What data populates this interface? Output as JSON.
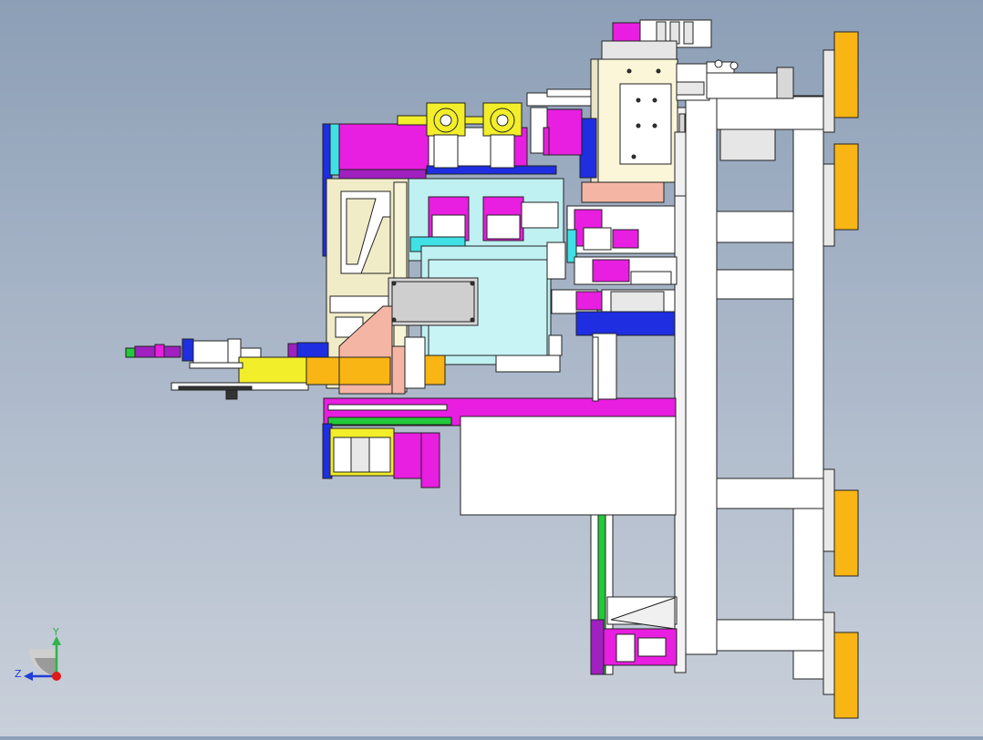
{
  "viewport": {
    "name": "cad-3d-viewport",
    "background_top": "#8c9fb6",
    "background_bottom": "#c9d0da"
  },
  "triad": {
    "y_label": "Y",
    "z_label": "Z",
    "y_color": "#2fb34a",
    "z_color": "#1f3fd6",
    "x_color": "#e01818"
  },
  "model_colors": {
    "magenta": "#e81ee0",
    "cyan": "#3fe0e6",
    "orange": "#f8b514",
    "yellow": "#f2ee2a",
    "blue": "#1e2ee0",
    "light_cyan": "#bff0f2",
    "white": "#ffffff",
    "cream": "#f1ecc8",
    "salmon": "#f5b5a5",
    "green": "#22c93a",
    "gray": "#b5b5b5",
    "purple": "#a020c0"
  }
}
